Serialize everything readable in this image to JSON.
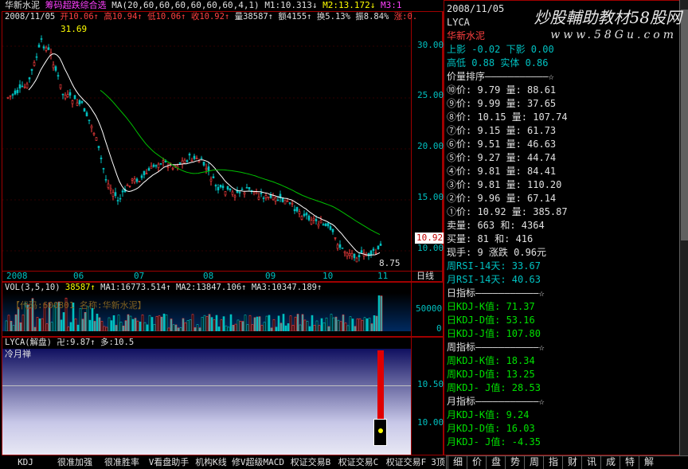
{
  "header": {
    "stock_name": "华新水泥",
    "indicator": "筹码超跌综合选",
    "ma_params": "MA(20,60,60,60,60,60,60,4,1)",
    "m1": "M1:10.313↓",
    "m2": "M2:13.172↓",
    "m3": "M3:1",
    "date": "2008/11/05",
    "open": "开10.06↑",
    "high": "高10.94↑",
    "low": "低10.06↑",
    "close": "收10.92↑",
    "volume": "量38587↑",
    "amount": "额4155↑",
    "turnover": "换5.13%",
    "amplitude": "振8.84%",
    "change": "涨:0."
  },
  "main_chart": {
    "peak_label": "31.69",
    "low_label": "8.75",
    "current_price_tag": "10.92",
    "y_ticks": [
      "30.00",
      "25.00",
      "20.00",
      "15.00",
      "10.00"
    ],
    "x_ticks": [
      "2008",
      "06",
      "07",
      "08",
      "09",
      "10",
      "11"
    ],
    "period_label": "日线"
  },
  "volume_panel": {
    "title": "VOL(3,5,10)",
    "vol": "38587↑",
    "ma1": "MA1:16773.514↑",
    "ma2": "MA2:13847.106↑",
    "ma3": "MA3:10347.189↑",
    "overlay_text": "【代码:600801 名称:华新水泥】",
    "y_ticks": [
      "50000",
      "0"
    ]
  },
  "lyca_panel": {
    "title": "LYCA(解盘)",
    "val1": "卍:9.87↑",
    "val2": "多:10.5",
    "label": "冷月禅",
    "y_ticks": [
      "10.50",
      "10.00"
    ]
  },
  "side": {
    "date": "2008/11/05",
    "code": "LYCA",
    "name": "华新水泥",
    "watermark": "炒股輔助教材58股网",
    "watermark_url": "www.58Gu.com",
    "row_shadow": "上影 -0.02  下影 0.00",
    "row_hilo": "高低  0.88  实体  0.86",
    "section_rank": "价量排序———————————☆",
    "rank_rows": [
      "⑩价: 9.79 量: 88.61",
      "⑨价: 9.99 量: 37.65",
      "⑧价: 10.15 量: 107.74",
      "⑦价: 9.15 量: 61.73",
      "⑥价: 9.51 量: 46.63",
      "⑤价: 9.27 量: 44.74",
      "④价: 9.81 量: 84.41",
      "③价: 9.81 量: 110.20",
      "②价: 9.96 量: 67.14",
      "①价: 10.92 量: 385.87"
    ],
    "sell": "卖量: 663 和: 4364",
    "buy": "买量: 81 和: 416",
    "now": "现手:   9  涨跌  0.96元",
    "rsi_week": "周RSI-14天:  33.67",
    "rsi_month": "月RSI-14天:  40.63",
    "section_day": "日指标———————————☆",
    "day_k": "日KDJ-K值:  71.37",
    "day_d": "日KDJ-D值:  53.16",
    "day_j": "日KDJ-J值:  107.80",
    "section_week": "周指标———————————☆",
    "week_k": "周KDJ-K值:  18.34",
    "week_d": "周KDJ-D值:  13.25",
    "week_j": "周KDJ- J值:   28.53",
    "section_month": "月指标———————————☆",
    "month_k": "月KDJ-K值:  9.24",
    "month_d": "月KDJ-D值:  16.03",
    "month_j": "月KDJ- J值:   -4.35"
  },
  "bottom_tabs": [
    "KDJ",
    "很准加强",
    "很准胜率",
    "V看盘助手",
    "机构K线",
    "修V超级MACD",
    "权证交易B",
    "权证交易C",
    "权证交易F",
    "3顶"
  ],
  "bottom_buttons": [
    "细",
    "价",
    "盘",
    "势",
    "周",
    "指",
    "财",
    "讯",
    "成",
    "特",
    "解"
  ],
  "colors": {
    "up": "#ff4040",
    "down": "#00c0c0",
    "frame": "#a00000",
    "ma1": "#ffffff",
    "ma2": "#00c000",
    "bg": "#000000"
  }
}
